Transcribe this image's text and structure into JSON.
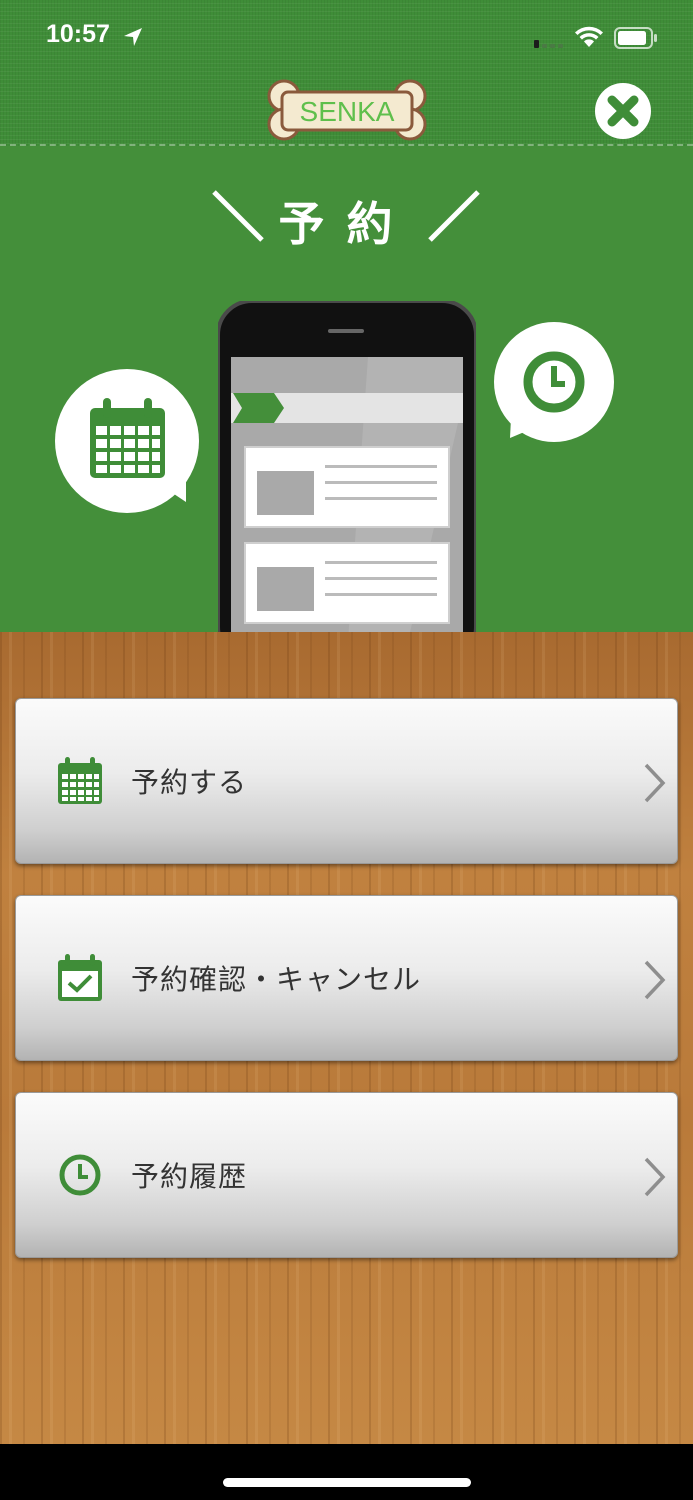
{
  "status_bar": {
    "time": "10:57"
  },
  "header": {
    "logo_text": "SENKA"
  },
  "hero": {
    "title": "予約"
  },
  "menu": {
    "items": [
      {
        "label": "予約する",
        "icon": "calendar-icon"
      },
      {
        "label": "予約確認・キャンセル",
        "icon": "calendar-check-icon"
      },
      {
        "label": "予約履歴",
        "icon": "clock-icon"
      }
    ]
  },
  "colors": {
    "brand_green": "#448f3a",
    "icon_green": "#3f8d38",
    "wood": "#b87a3c"
  }
}
